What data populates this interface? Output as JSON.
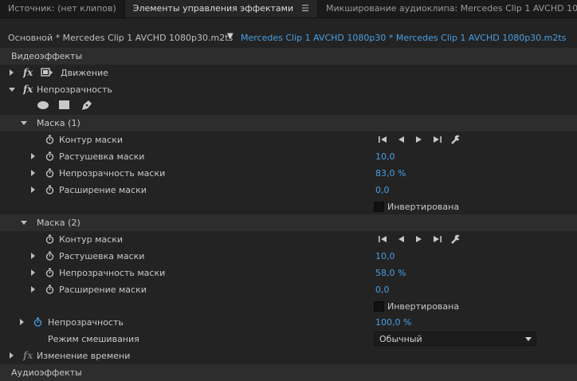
{
  "tabs": [
    {
      "label": "Источник: (нет клипов)",
      "active": false
    },
    {
      "label": "Элементы управления эффектами",
      "active": true
    },
    {
      "label": "Микширование аудиоклипа: Mercedes Clip 1 AVCHD 1080p30",
      "active": false
    }
  ],
  "header": {
    "master_clip": "Основной * Mercedes Clip 1 AVCHD 1080p30.m2ts",
    "sequence_clip": "Mercedes Clip 1 AVCHD 1080p30 * Mercedes Clip 1 AVCHD 1080p30.m2ts"
  },
  "video_effects_label": "Видеоэффекты",
  "motion": {
    "label": "Движение"
  },
  "opacity_effect": {
    "label": "Непрозрачность"
  },
  "masks": [
    {
      "label": "Маска (1)",
      "path_label": "Контур маски",
      "feather_label": "Растушевка маски",
      "feather_value": "10,0",
      "opacity_label": "Непрозрачность маски",
      "opacity_value": "83,0 %",
      "expansion_label": "Расширение маски",
      "expansion_value": "0,0",
      "inverted_label": "Инвертирована"
    },
    {
      "label": "Маска (2)",
      "path_label": "Контур маски",
      "feather_label": "Растушевка маски",
      "feather_value": "10,0",
      "opacity_label": "Непрозрачность маски",
      "opacity_value": "58,0 %",
      "expansion_label": "Расширение маски",
      "expansion_value": "0,0",
      "inverted_label": "Инвертирована"
    }
  ],
  "opacity_param": {
    "label": "Непрозрачность",
    "value": "100,0 %"
  },
  "blend_mode": {
    "label": "Режим смешивания",
    "value": "Обычный"
  },
  "time_remap": {
    "label": "Изменение времени"
  },
  "audio_effects_label": "Аудиоэффекты",
  "colors": {
    "accent": "#4a9fe3",
    "background": "#232323",
    "section": "#2d2d2d"
  }
}
